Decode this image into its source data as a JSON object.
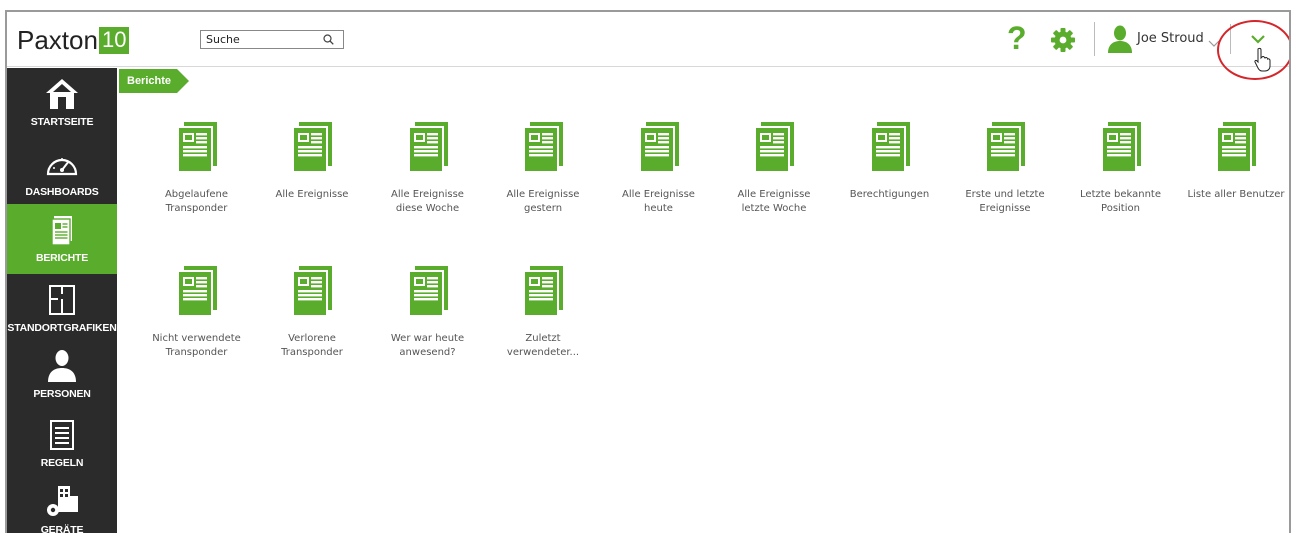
{
  "app": {
    "logo_text": "Paxton",
    "logo_number": "10"
  },
  "header": {
    "search_placeholder": "Suche",
    "help_label": "?",
    "user_name": "Joe Stroud"
  },
  "sidebar": {
    "items": [
      {
        "label": "STARTSEITE",
        "icon": "home-icon",
        "active": false
      },
      {
        "label": "DASHBOARDS",
        "icon": "gauge-icon",
        "active": false
      },
      {
        "label": "BERICHTE",
        "icon": "report-icon",
        "active": true
      },
      {
        "label": "STANDORTGRAFIKEN",
        "icon": "floorplan-icon",
        "active": false
      },
      {
        "label": "PERSONEN",
        "icon": "person-icon",
        "active": false
      },
      {
        "label": "REGELN",
        "icon": "rules-icon",
        "active": false
      },
      {
        "label": "GERÄTE",
        "icon": "devices-icon",
        "active": false
      }
    ]
  },
  "breadcrumb": {
    "current": "Berichte"
  },
  "reports": [
    {
      "line1": "Abgelaufene",
      "line2": "Transponder"
    },
    {
      "line1": "Alle Ereignisse",
      "line2": ""
    },
    {
      "line1": "Alle Ereignisse",
      "line2": "diese Woche"
    },
    {
      "line1": "Alle Ereignisse",
      "line2": "gestern"
    },
    {
      "line1": "Alle Ereignisse",
      "line2": "heute"
    },
    {
      "line1": "Alle Ereignisse",
      "line2": "letzte Woche"
    },
    {
      "line1": "Berechtigungen",
      "line2": ""
    },
    {
      "line1": "Erste und letzte",
      "line2": "Ereignisse"
    },
    {
      "line1": "Letzte bekannte",
      "line2": "Position"
    },
    {
      "line1": "Liste aller Benutzer",
      "line2": ""
    },
    {
      "line1": "Nicht verwendete",
      "line2": "Transponder"
    },
    {
      "line1": "Verlorene",
      "line2": "Transponder"
    },
    {
      "line1": "Wer war heute",
      "line2": "anwesend?"
    },
    {
      "line1": "Zuletzt",
      "line2": "verwendeter..."
    }
  ],
  "colors": {
    "accent": "#5aac2c",
    "sidebar_bg": "#2b2b2b",
    "highlight": "#d4262b"
  }
}
